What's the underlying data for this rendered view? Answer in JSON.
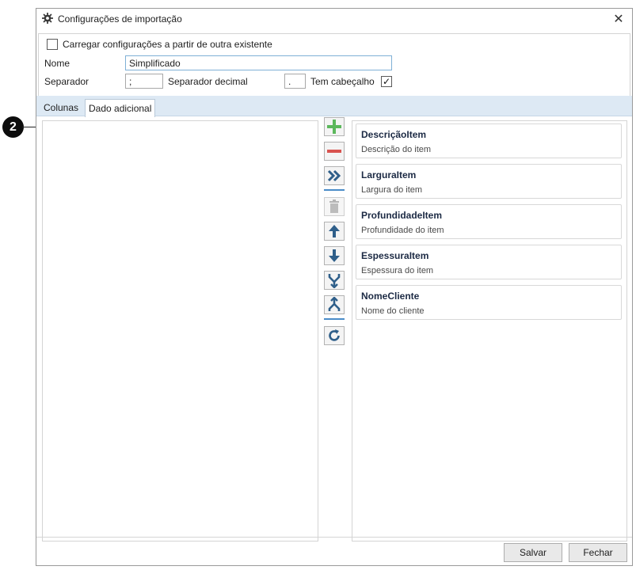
{
  "window": {
    "title": "Configurações de importação",
    "close_glyph": "✕"
  },
  "form": {
    "load_existing_label": "Carregar configurações a partir de outra existente",
    "load_existing_checked": false,
    "name_label": "Nome",
    "name_value": "Simplificado",
    "separator_label": "Separador",
    "separator_value": ";",
    "decimal_separator_label": "Separador decimal",
    "decimal_separator_value": ".",
    "has_header_label": "Tem cabeçalho",
    "has_header_checked": true,
    "check_glyph": "✓"
  },
  "tabs": [
    {
      "label": "Colunas",
      "active": false
    },
    {
      "label": "Dado adicional",
      "active": true
    }
  ],
  "toolbar": {
    "icons": [
      "add-icon",
      "remove-icon",
      "move-all-icon",
      "delete-icon",
      "move-up-icon",
      "move-down-icon",
      "merge-icon",
      "split-icon",
      "refresh-icon"
    ],
    "colors": {
      "add": "#5cb85c",
      "remove": "#d9534f",
      "accent": "#2f5f8a"
    }
  },
  "fields": [
    {
      "name": "DescriçãoItem",
      "description": "Descrição do item"
    },
    {
      "name": "LarguraItem",
      "description": "Largura do item"
    },
    {
      "name": "ProfundidadeItem",
      "description": "Profundidade do item"
    },
    {
      "name": "EspessuraItem",
      "description": "Espessura do item"
    },
    {
      "name": "NomeCliente",
      "description": "Nome do cliente"
    }
  ],
  "buttons": {
    "save_label": "Salvar",
    "close_label": "Fechar"
  },
  "callout": {
    "number": "2"
  }
}
